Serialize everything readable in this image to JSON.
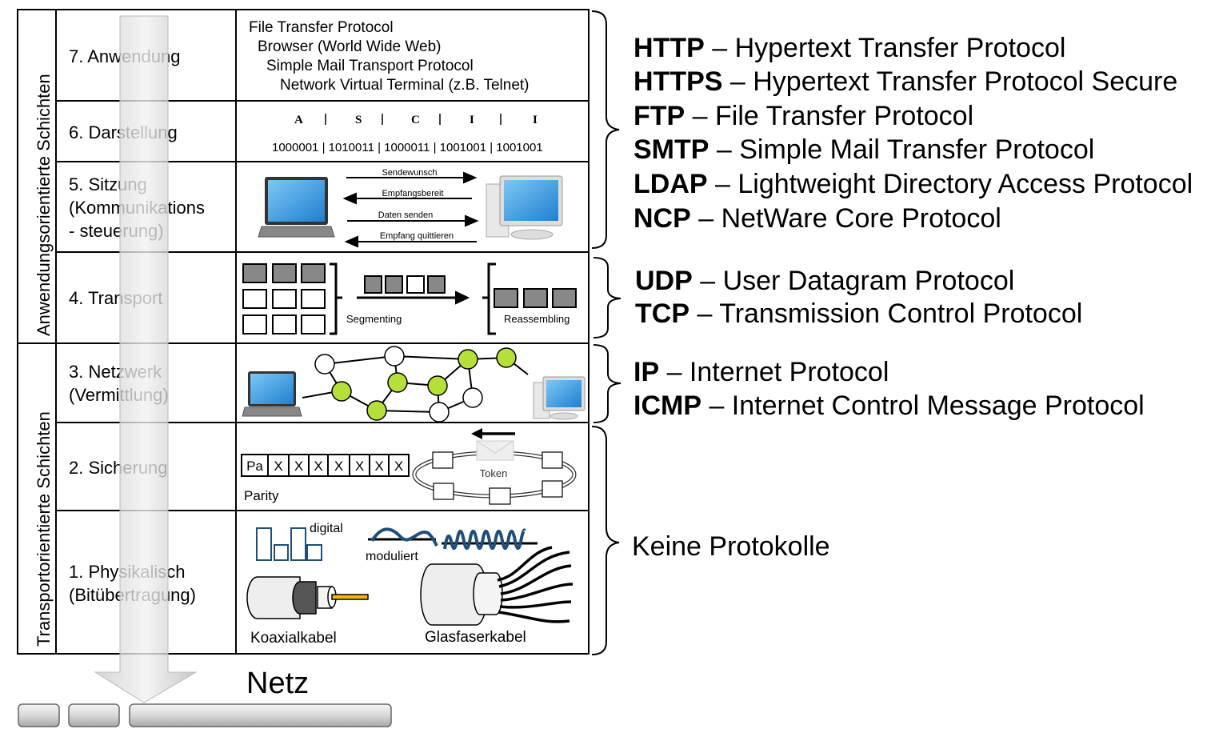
{
  "side_labels": {
    "upper": "Anwendungsorientierte Schichten",
    "lower": "Transportorientierte Schichten"
  },
  "layers": [
    {
      "name": [
        "7. Anwendung"
      ]
    },
    {
      "name": [
        "6. Darstellung"
      ]
    },
    {
      "name": [
        "5. Sitzung",
        "(Kommunikations",
        "- steuerung)"
      ]
    },
    {
      "name": [
        "4. Transport"
      ]
    },
    {
      "name": [
        "3. Netzwerk",
        "(Vermittlung)"
      ]
    },
    {
      "name": [
        "2. Sicherung"
      ]
    },
    {
      "name": [
        "1. Physikalisch",
        "(Bitübertragung)"
      ]
    }
  ],
  "application": [
    "File Transfer Protocol",
    "Browser (World Wide Web)",
    "Simple Mail Transport Protocol",
    "Network Virtual Terminal (z.B. Telnet)"
  ],
  "presentation": {
    "letters": [
      "A",
      "S",
      "C",
      "I",
      "I"
    ],
    "binary": "1000001 | 1010011 | 1000011 | 1001001 | 1001001"
  },
  "session": [
    "Sendewunsch",
    "Empfangsbereit",
    "Daten senden",
    "Empfang quittieren"
  ],
  "transport": {
    "segmenting": "Segmenting",
    "reassembling": "Reassembling"
  },
  "datalink": {
    "cells": [
      "Pa",
      "X",
      "X",
      "X",
      "X",
      "X",
      "X",
      "X"
    ],
    "parity": "Parity",
    "token": "Token"
  },
  "physical": {
    "digital": "digital",
    "moduliert": "moduliert",
    "coax": "Koaxialkabel",
    "fiber": "Glasfaserkabel"
  },
  "netz": "Netz",
  "protocols": {
    "application": [
      [
        "HTTP",
        " – Hypertext Transfer Protocol"
      ],
      [
        "HTTPS",
        " – Hypertext Transfer Protocol Secure"
      ],
      [
        "FTP",
        " – File Transfer Protocol"
      ],
      [
        "SMTP",
        " – Simple Mail Transfer Protocol"
      ],
      [
        "LDAP",
        " – Lightweight Directory Access Protocol"
      ],
      [
        "NCP",
        " – NetWare Core Protocol"
      ]
    ],
    "transport": [
      [
        "UDP",
        " – User Datagram Protocol"
      ],
      [
        "TCP",
        " – Transmission Control Protocol"
      ]
    ],
    "network": [
      [
        "IP",
        " – Internet Protocol"
      ],
      [
        "ICMP",
        " – Internet Control Message Protocol"
      ]
    ],
    "none": "Keine Protokolle"
  },
  "colors": {
    "node_green": "#b5e03a",
    "signal_blue": "#1f4e79",
    "screen_blue": "#3a9be0",
    "arrow_gray": "#d0d0d0"
  }
}
